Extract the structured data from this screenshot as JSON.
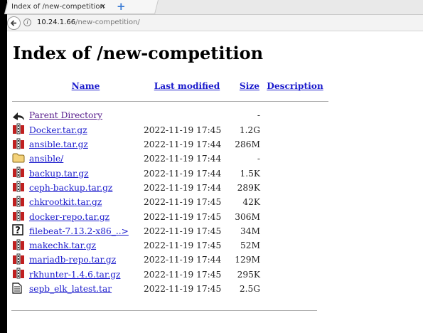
{
  "browser": {
    "tab_title": "Index of /new-competition",
    "tab_close": "×",
    "new_tab": "+",
    "url_host": "10.24.1.66",
    "url_path": "/new-competition/"
  },
  "page": {
    "title": "Index of /new-competition",
    "headers": {
      "name": "Name",
      "last_modified": "Last modified",
      "size": "Size",
      "description": "Description"
    },
    "parent": {
      "name": "Parent Directory",
      "date": "",
      "size": "-"
    },
    "rows": [
      {
        "icon": "archive-icon",
        "name": "Docker.tar.gz",
        "date": "2022-11-19 17:45",
        "size": "1.2G"
      },
      {
        "icon": "archive-icon",
        "name": "ansible.tar.gz",
        "date": "2022-11-19 17:44",
        "size": "286M"
      },
      {
        "icon": "folder-icon",
        "name": "ansible/",
        "date": "2022-11-19 17:44",
        "size": "-"
      },
      {
        "icon": "archive-icon",
        "name": "backup.tar.gz",
        "date": "2022-11-19 17:44",
        "size": "1.5K"
      },
      {
        "icon": "archive-icon",
        "name": "ceph-backup.tar.gz",
        "date": "2022-11-19 17:44",
        "size": "289K"
      },
      {
        "icon": "archive-icon",
        "name": "chkrootkit.tar.gz",
        "date": "2022-11-19 17:45",
        "size": "42K"
      },
      {
        "icon": "archive-icon",
        "name": "docker-repo.tar.gz",
        "date": "2022-11-19 17:45",
        "size": "306M"
      },
      {
        "icon": "unknown-file-icon",
        "name": "filebeat-7.13.2-x86_..>",
        "date": "2022-11-19 17:45",
        "size": "34M"
      },
      {
        "icon": "archive-icon",
        "name": "makechk.tar.gz",
        "date": "2022-11-19 17:45",
        "size": "52M"
      },
      {
        "icon": "archive-icon",
        "name": "mariadb-repo.tar.gz",
        "date": "2022-11-19 17:44",
        "size": "129M"
      },
      {
        "icon": "archive-icon",
        "name": "rkhunter-1.4.6.tar.gz",
        "date": "2022-11-19 17:45",
        "size": "295K"
      },
      {
        "icon": "text-file-icon",
        "name": "sepb_elk_latest.tar",
        "date": "2022-11-19 17:45",
        "size": "2.5G"
      }
    ]
  },
  "colors": {
    "link": "#1a1acc",
    "visited_link": "#551a8b",
    "archive_icon": "#c02020"
  }
}
